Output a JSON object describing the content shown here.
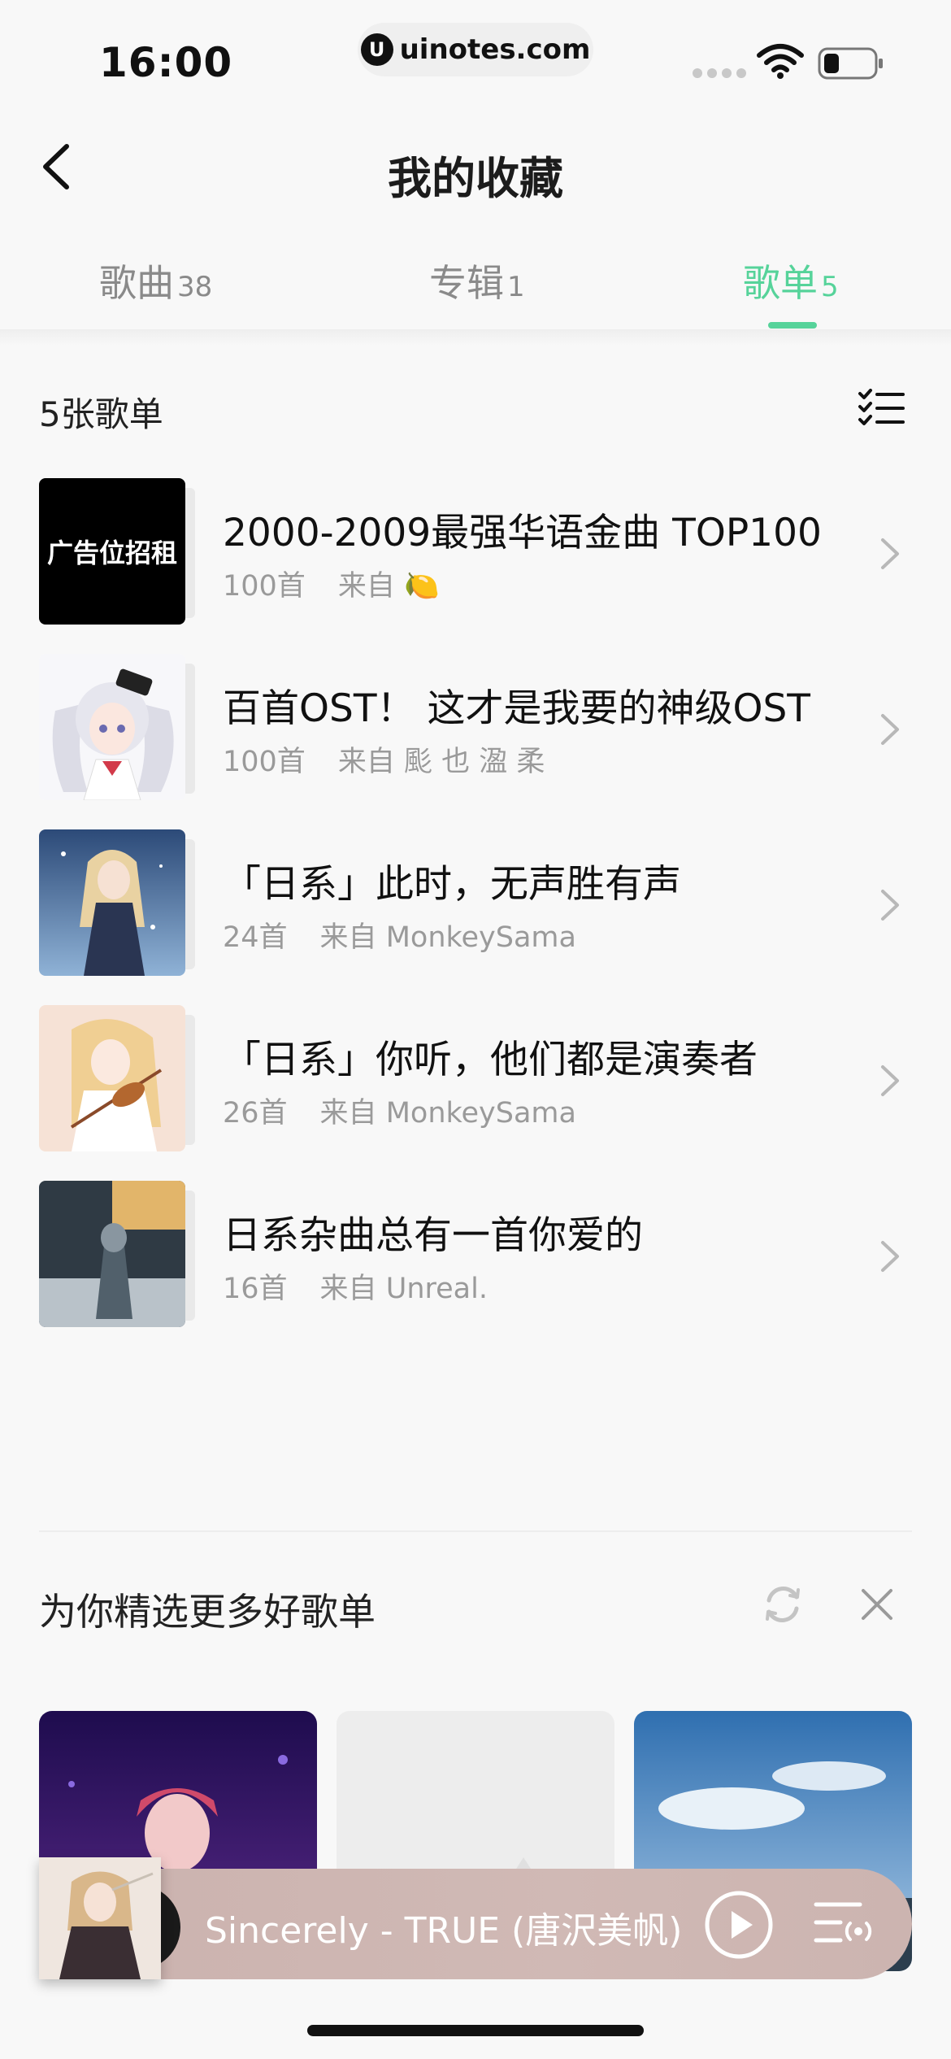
{
  "status": {
    "time": "16:00",
    "url": "uinotes.com",
    "logo_glyph": "U"
  },
  "header": {
    "title": "我的收藏"
  },
  "tabs": [
    {
      "label": "歌曲",
      "count": "38",
      "active": false
    },
    {
      "label": "专辑",
      "count": "1",
      "active": false
    },
    {
      "label": "歌单",
      "count": "5",
      "active": true
    }
  ],
  "list": {
    "count_label": "5张歌单",
    "items": [
      {
        "title": "2000-2009最强华语金曲 TOP100",
        "tracks": "100首",
        "from": "来自",
        "creator": "🍋",
        "cover_text": "广告位招租"
      },
      {
        "title": "百首OST！ 这才是我要的神级OST",
        "tracks": "100首",
        "from": "来自",
        "creator": "颩 也 溋 柔",
        "cover_text": ""
      },
      {
        "title": "「日系」此时，无声胜有声",
        "tracks": "24首",
        "from": "来自",
        "creator": "MonkeySama",
        "cover_text": ""
      },
      {
        "title": "「日系」你听，他们都是演奏者",
        "tracks": "26首",
        "from": "来自",
        "creator": "MonkeySama",
        "cover_text": ""
      },
      {
        "title": "日系杂曲总有一首你爱的",
        "tracks": "16首",
        "from": "来自",
        "creator": "Unreal.",
        "cover_text": ""
      }
    ]
  },
  "recommend": {
    "title": "为你精选更多好歌单"
  },
  "player": {
    "now_playing": "Sincerely - TRUE (唐沢美帆)"
  },
  "colors": {
    "accent": "#56d39a",
    "player_bg": "#cbb2ae"
  }
}
